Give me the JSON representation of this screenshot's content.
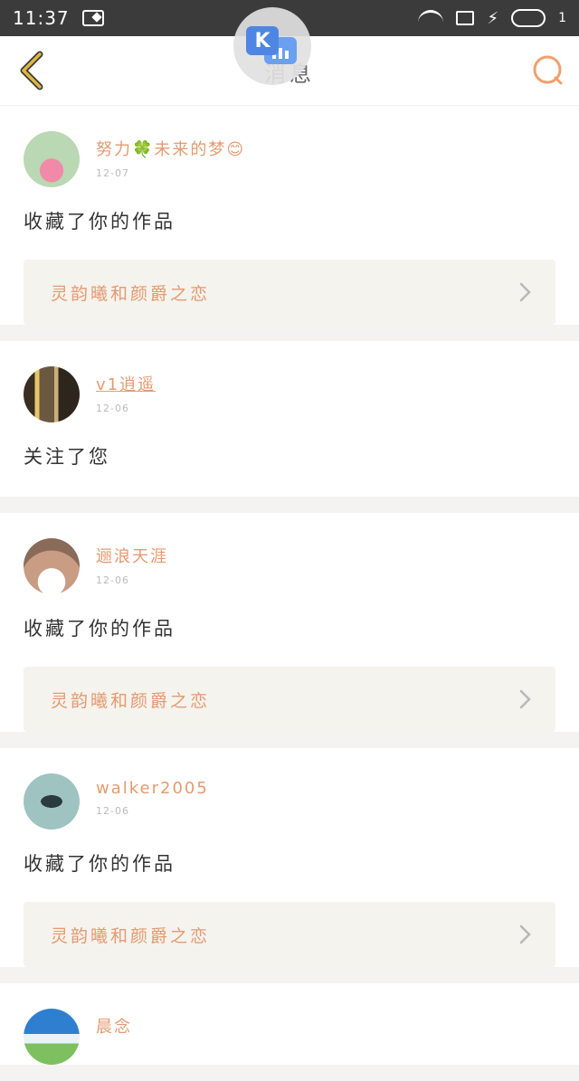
{
  "status_bar": {
    "time": "11:37",
    "battery_level": "1"
  },
  "header": {
    "title": "消息"
  },
  "messages": [
    {
      "username": "努力🍀未来的梦😊",
      "date": "12-07",
      "action": "收藏了你的作品",
      "work_title": "灵韵曦和颜爵之恋",
      "avatar_color": "#b8d6b0"
    },
    {
      "username": "v1逍遥",
      "date": "12-06",
      "action": "关注了您",
      "work_title": "",
      "avatar_color": "#6b5a3e"
    },
    {
      "username": "逦浪天涯",
      "date": "12-06",
      "action": "收藏了你的作品",
      "work_title": "灵韵曦和颜爵之恋",
      "avatar_color": "#c9a08a"
    },
    {
      "username": "walker2005",
      "date": "12-06",
      "action": "收藏了你的作品",
      "work_title": "灵韵曦和颜爵之恋",
      "avatar_color": "#9ec3c1"
    },
    {
      "username": "晨念",
      "date": "",
      "action": "",
      "work_title": "",
      "avatar_color": "#5a9ad6"
    }
  ],
  "colors": {
    "accent": "#e69a70",
    "back_icon": "#e0b640",
    "search_icon": "#f0a070"
  }
}
